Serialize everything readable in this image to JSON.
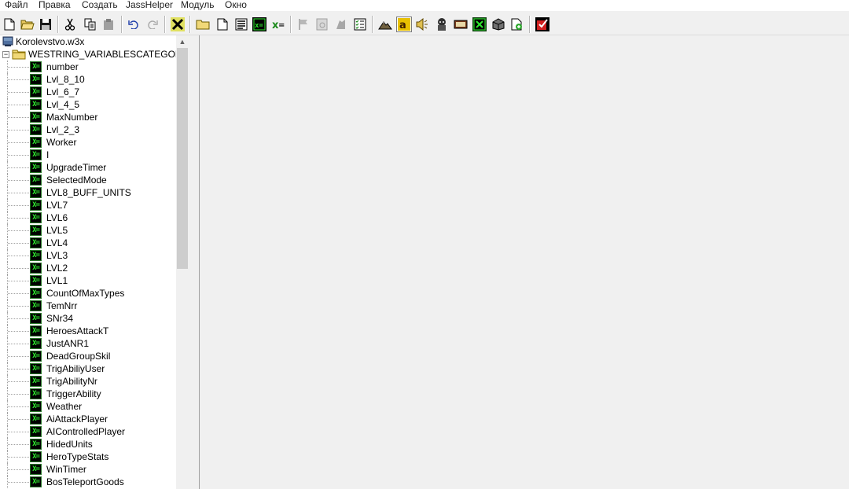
{
  "menu": {
    "items": [
      "Файл",
      "Правка",
      "Создать",
      "JassHelper",
      "Модуль",
      "Окно"
    ]
  },
  "toolbar": {
    "buttons": [
      {
        "id": "new",
        "icon": "new-document-icon"
      },
      {
        "id": "open",
        "icon": "open-folder-icon"
      },
      {
        "id": "save",
        "icon": "save-disk-icon"
      },
      {
        "id": "cut",
        "icon": "scissors-icon"
      },
      {
        "id": "copy",
        "icon": "copy-icon"
      },
      {
        "id": "paste",
        "icon": "paste-icon"
      },
      {
        "id": "undo",
        "icon": "undo-icon"
      },
      {
        "id": "redo",
        "icon": "redo-icon"
      },
      {
        "id": "delete",
        "icon": "delete-x-icon"
      },
      {
        "id": "new-category",
        "icon": "new-category-icon"
      },
      {
        "id": "new-trigger",
        "icon": "new-trigger-icon"
      },
      {
        "id": "new-comment",
        "icon": "new-comment-icon"
      },
      {
        "id": "variables",
        "icon": "variables-icon"
      },
      {
        "id": "new-variable",
        "icon": "new-variable-icon"
      },
      {
        "id": "test",
        "icon": "flag-icon"
      },
      {
        "id": "disabled-2",
        "icon": "disabled-tool-icon"
      },
      {
        "id": "disabled-3",
        "icon": "disabled-hand-icon"
      },
      {
        "id": "checklist",
        "icon": "checklist-icon"
      },
      {
        "id": "terrain-editor",
        "icon": "terrain-icon"
      },
      {
        "id": "trigger-editor",
        "icon": "trigger-editor-icon"
      },
      {
        "id": "sound-editor",
        "icon": "speaker-icon"
      },
      {
        "id": "object-editor",
        "icon": "object-editor-icon"
      },
      {
        "id": "campaign-editor",
        "icon": "campaign-editor-icon"
      },
      {
        "id": "ai-editor",
        "icon": "ai-editor-icon"
      },
      {
        "id": "import-manager",
        "icon": "import-manager-icon"
      },
      {
        "id": "script-editor",
        "icon": "script-editor-icon"
      },
      {
        "id": "test-map",
        "icon": "test-map-icon"
      }
    ]
  },
  "tree": {
    "root_label": "Korolevstvo.w3x",
    "category_label": "WESTRING_VARIABLESCATEGORY",
    "variable_icon_text": "X=",
    "variables": [
      "number",
      "Lvl_8_10",
      "Lvl_6_7",
      "Lvl_4_5",
      "MaxNumber",
      "Lvl_2_3",
      "Worker",
      "I",
      "UpgradeTimer",
      "SelectedMode",
      "LVL8_BUFF_UNITS",
      "LVL7",
      "LVL6",
      "LVL5",
      "LVL4",
      "LVL3",
      "LVL2",
      "LVL1",
      "CountOfMaxTypes",
      "TemNrr",
      "SNr34",
      "HeroesAttackT",
      "JustANR1",
      "DeadGroupSkil",
      "TrigAbiliyUser",
      "TrigAbilityNr",
      "TriggerAbility",
      "Weather",
      "AiAttackPlayer",
      "AIControlledPlayer",
      "HidedUnits",
      "HeroTypeStats",
      "WinTimer",
      "BosTeleportGoods"
    ]
  },
  "colors": {
    "variable_icon_bg": "#000000",
    "variable_icon_fg": "#2ee82e",
    "panel_bg": "#f0f0f0"
  }
}
